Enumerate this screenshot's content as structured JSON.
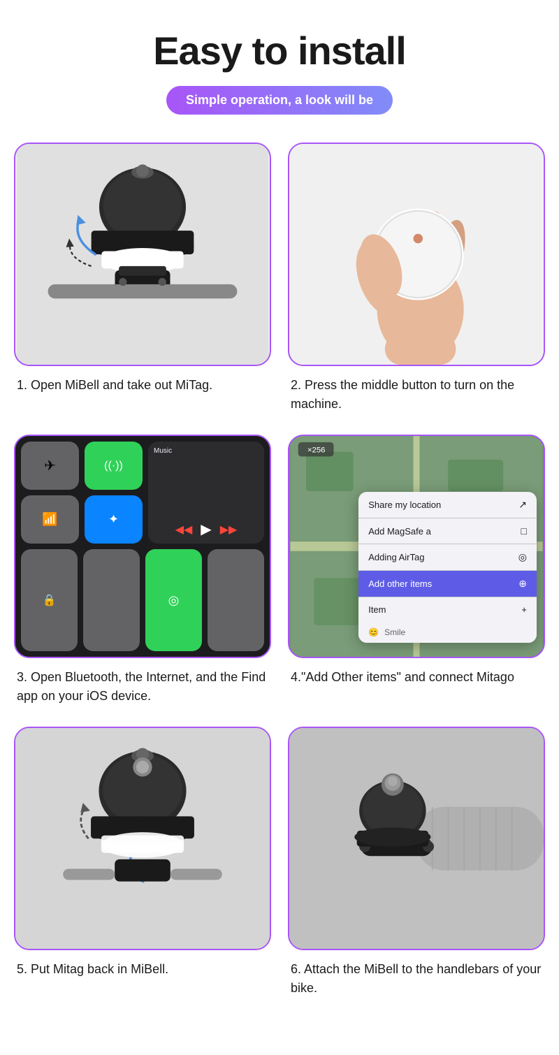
{
  "page": {
    "title": "Easy to install",
    "subtitle": "Simple operation, a look will be"
  },
  "steps": [
    {
      "number": "1",
      "caption": "1. Open MiBell and take out MiTag."
    },
    {
      "number": "2",
      "caption": "2. Press the middle button to turn on the machine."
    },
    {
      "number": "3",
      "caption": "3. Open Bluetooth, the Internet, and the Find app on your iOS device."
    },
    {
      "number": "4",
      "caption": "4.\"Add Other items\" and connect Mitago"
    },
    {
      "number": "5",
      "caption": "5. Put Mitag back in MiBell."
    },
    {
      "number": "6",
      "caption": "6. Attach the MiBell to the handlebars of your bike."
    }
  ],
  "find_menu": {
    "items": [
      {
        "label": "Share my location",
        "icon": "↗",
        "highlighted": false
      },
      {
        "label": "Add MagSafe a",
        "icon": "□",
        "highlighted": false
      },
      {
        "label": "Adding AirTag",
        "icon": "◎",
        "highlighted": false
      },
      {
        "label": "Add other items",
        "icon": "⊕",
        "highlighted": true
      }
    ],
    "section_label": "Item",
    "smile_label": "Smile"
  },
  "control_center": {
    "music_label": "Music"
  },
  "colors": {
    "purple": "#a855f7",
    "title": "#1a1a1a",
    "caption": "#1a1a1a",
    "highlight_blue": "#5e5ce6"
  }
}
